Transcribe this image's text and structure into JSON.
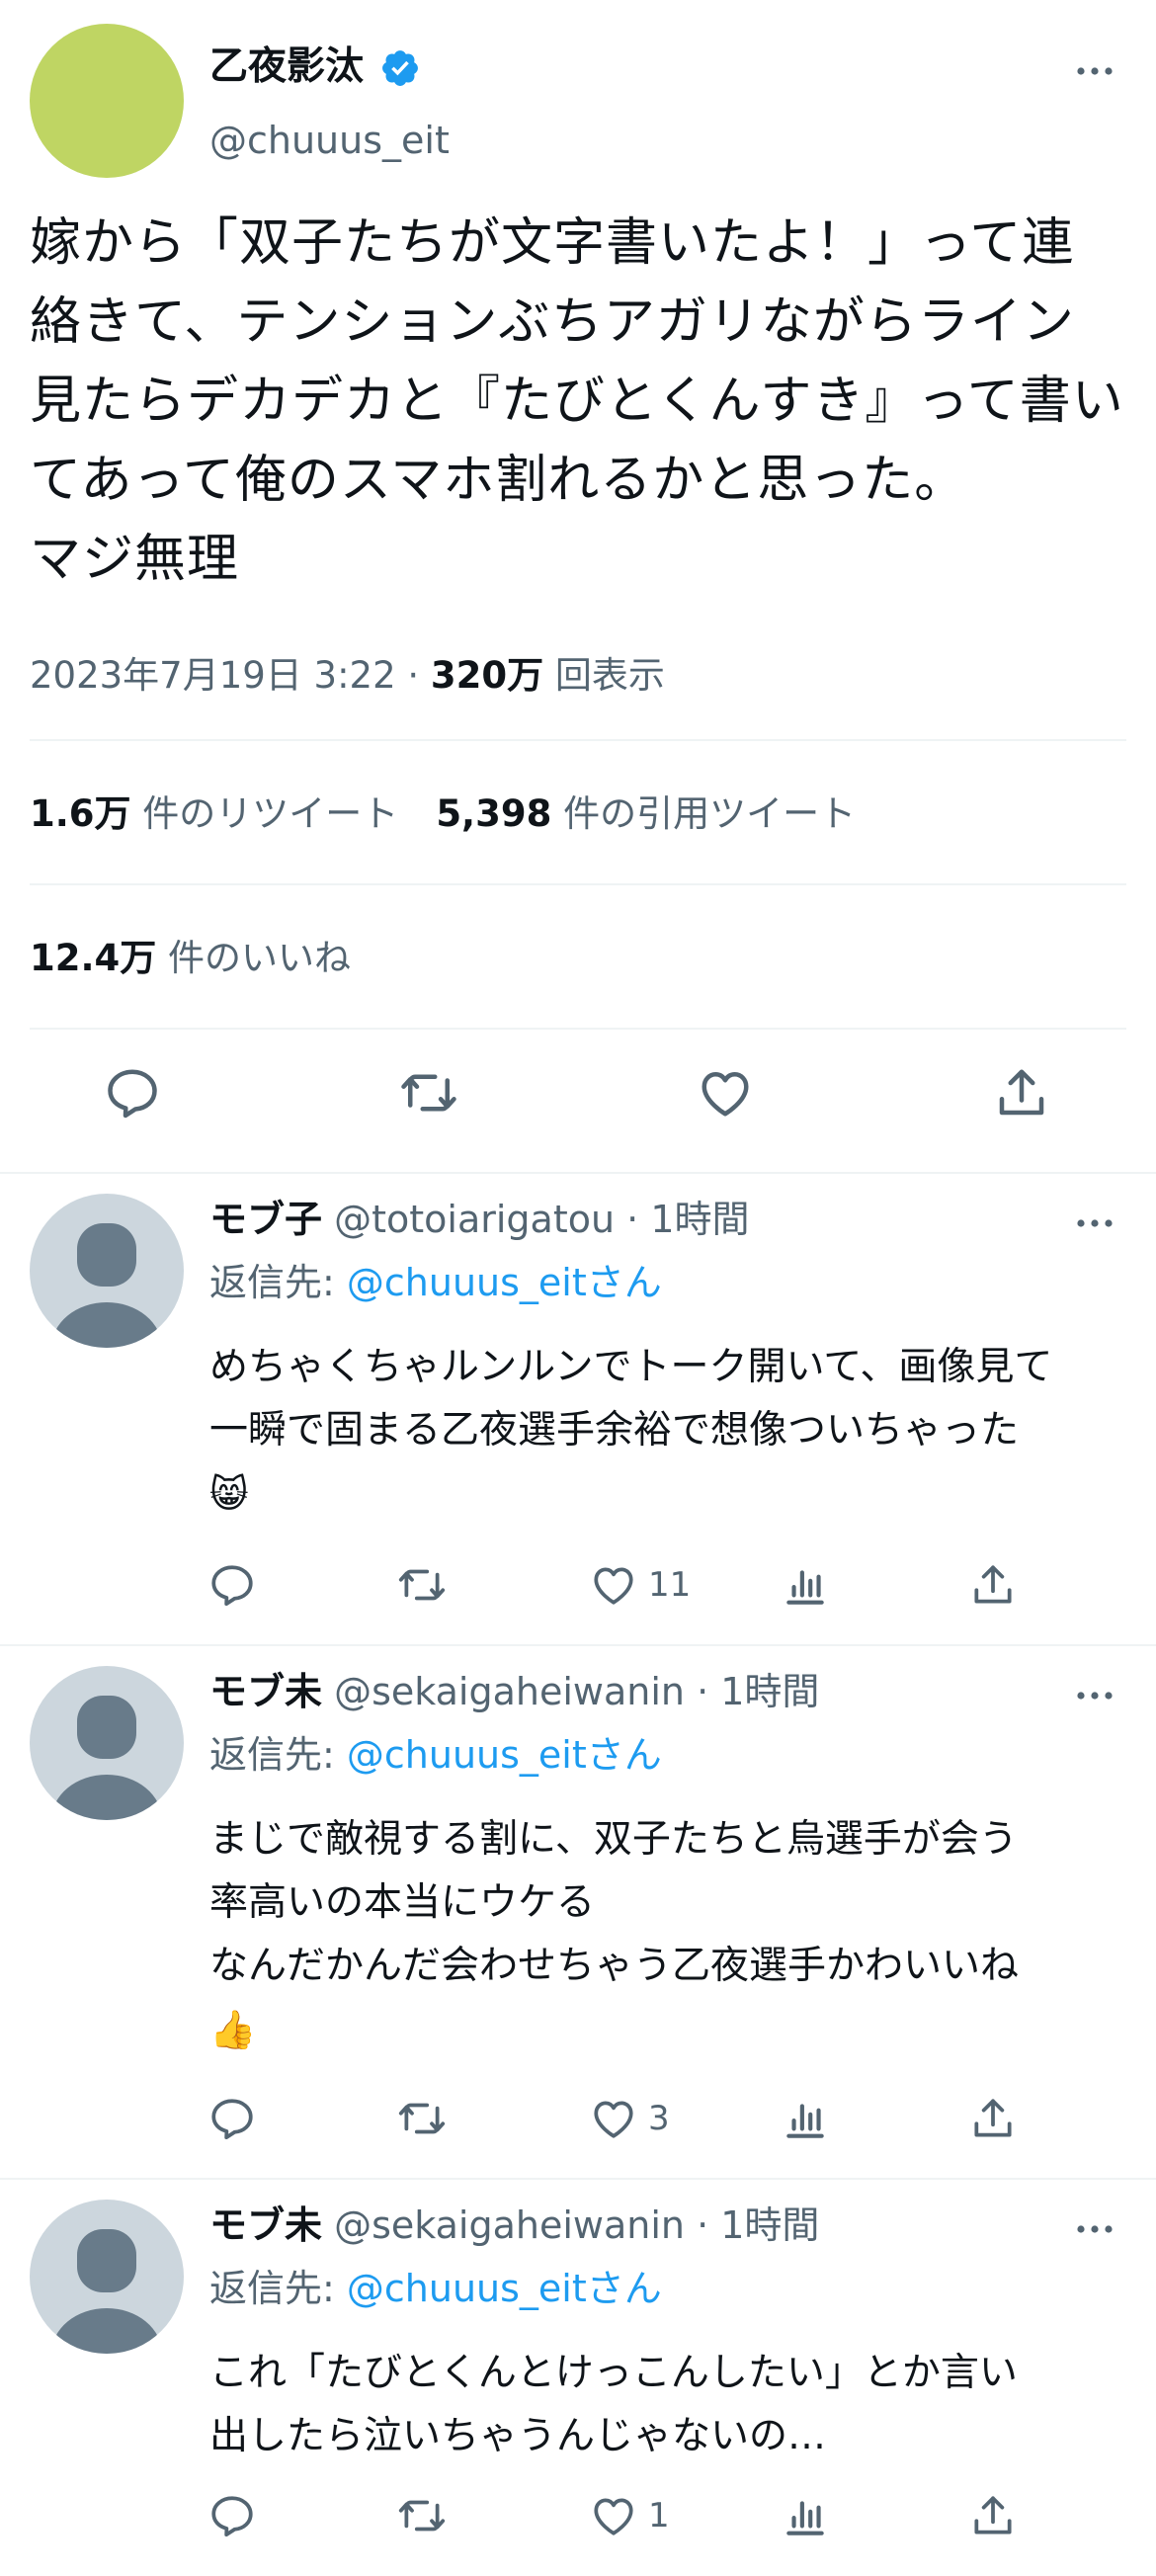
{
  "main_tweet": {
    "author_name": "乙夜影汰",
    "handle": "@chuuus_eit",
    "text": "嫁から「双子たちが文字書いたよ！」って連\n絡きて、テンションぶちアガリながらライン\n見たらデカデカと『たびとくんすき』って書い\nてあって俺のスマホ割れるかと思った。\nマジ無理",
    "timestamp": "2023年7月19日 3:22 · ",
    "views_count": "320万",
    "views_label": " 回表示",
    "retweets_count": "1.6万",
    "retweets_label": " 件のリツイート",
    "quotes_count": "5,398",
    "quotes_label": " 件の引用ツイート",
    "likes_count": "12.4万",
    "likes_label": " 件のいいね",
    "avatar_color": "#bfd563",
    "verified_color": "#1d9bf0"
  },
  "replies": [
    {
      "name": "モブ子",
      "handle": "@totoiarigatou",
      "time": " · 1時間",
      "reply_to_label": "返信先: ",
      "reply_to_mention": "@chuuus_eitさん",
      "text": "めちゃくちゃルンルンでトーク開いて、画像見て\n一瞬で固まる乙夜選手余裕で想像ついちゃった",
      "emoji": "😸",
      "likes": "11"
    },
    {
      "name": "モブ未",
      "handle": "@sekaigaheiwanin",
      "time": " · 1時間",
      "reply_to_label": "返信先: ",
      "reply_to_mention": "@chuuus_eitさん",
      "text": "まじで敵視する割に、双子たちと烏選手が会う\n率高いの本当にウケる\nなんだかんだ会わせちゃう乙夜選手かわいいね",
      "emoji": "👍",
      "likes": "3"
    },
    {
      "name": "モブ未",
      "handle": "@sekaigaheiwanin",
      "time": " · 1時間",
      "reply_to_label": "返信先: ",
      "reply_to_mention": "@chuuus_eitさん",
      "text": "これ「たびとくんとけっこんしたい」とか言い\n出したら泣いちゃうんじゃないの…",
      "emoji": "",
      "likes": "1"
    }
  ],
  "icons": {
    "more": "more-icon",
    "reply": "reply-icon",
    "retweet": "retweet-icon",
    "like": "like-icon",
    "views": "analytics-icon",
    "share": "share-icon"
  },
  "colors": {
    "text": "#0f1419",
    "secondary": "#536471",
    "link": "#1d9bf0",
    "divider": "#eff3f4",
    "default_avatar_bg": "#ccd6dd",
    "default_avatar_fg": "#687b8a"
  }
}
